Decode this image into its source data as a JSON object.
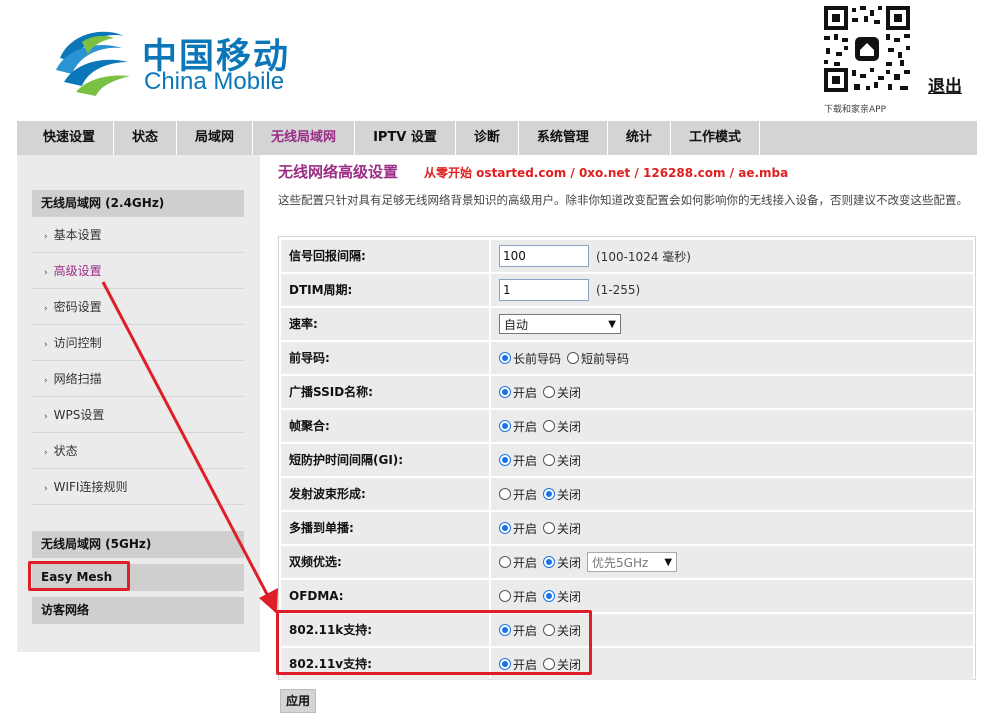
{
  "brand": {
    "name_cn": "中国移动",
    "name_en": "China Mobile",
    "qr_caption": "下载和家亲APP",
    "color": "#0b77b8"
  },
  "header": {
    "logout_label": "退出"
  },
  "nav": {
    "items": [
      "快速设置",
      "状态",
      "局域网",
      "无线局域网",
      "IPTV 设置",
      "诊断",
      "系统管理",
      "统计",
      "工作模式"
    ],
    "active": "无线局域网"
  },
  "sidebar": {
    "group_24": "无线局域网 (2.4GHz)",
    "items": [
      "基本设置",
      "高级设置",
      "密码设置",
      "访问控制",
      "网络扫描",
      "WPS设置",
      "状态",
      "WIFI连接规则"
    ],
    "active": "高级设置",
    "group_5g": "无线局域网 (5GHz)",
    "easy_mesh": "Easy Mesh",
    "guest": "访客网络"
  },
  "main": {
    "title": "无线网络高级设置",
    "watermark": "从零开始 ostarted.com / 0xo.net / 126288.com / ae.mba",
    "description": "这些配置只针对具有足够无线网络背景知识的高级用户。除非你知道改变配置会如何影响你的无线接入设备，否则建议不改变这些配置。",
    "apply_label": "应用"
  },
  "form": {
    "beacon": {
      "label": "信号回报间隔:",
      "value": "100",
      "hint": "(100-1024 毫秒)"
    },
    "dtim": {
      "label": "DTIM周期:",
      "value": "1",
      "hint": "(1-255)"
    },
    "rate": {
      "label": "速率:",
      "value": "自动"
    },
    "preamble": {
      "label": "前导码:",
      "opt1": "长前导码",
      "opt2": "短前导码",
      "selected": 1
    },
    "ssid_broadcast": {
      "label": "广播SSID名称:",
      "opt1": "开启",
      "opt2": "关闭",
      "selected": 1
    },
    "aggregation": {
      "label": "帧聚合:",
      "opt1": "开启",
      "opt2": "关闭",
      "selected": 1
    },
    "short_gi": {
      "label": "短防护时间间隔(GI):",
      "opt1": "开启",
      "opt2": "关闭",
      "selected": 1
    },
    "beamforming": {
      "label": "发射波束形成:",
      "opt1": "开启",
      "opt2": "关闭",
      "selected": 2
    },
    "mcast_to_ucast": {
      "label": "多播到单播:",
      "opt1": "开启",
      "opt2": "关闭",
      "selected": 1
    },
    "band_steering": {
      "label": "双频优选:",
      "opt1": "开启",
      "opt2": "关闭",
      "selected": 2,
      "select_value": "优先5GHz"
    },
    "ofdma": {
      "label": "OFDMA:",
      "opt1": "开启",
      "opt2": "关闭",
      "selected": 2
    },
    "dot11k": {
      "label": "802.11k支持:",
      "opt1": "开启",
      "opt2": "关闭",
      "selected": 1
    },
    "dot11v": {
      "label": "802.11v支持:",
      "opt1": "开启",
      "opt2": "关闭",
      "selected": 1
    }
  },
  "colors": {
    "accent": "#9b2d86",
    "annotation_red": "#e01e2a",
    "radio_blue": "#1a73e8"
  }
}
